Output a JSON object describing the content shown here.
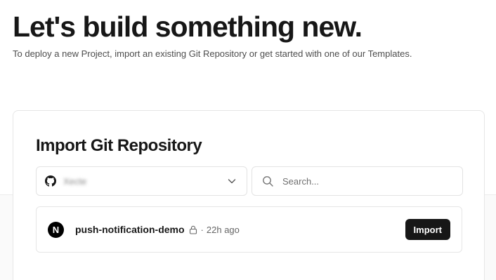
{
  "hero": {
    "title": "Let's build something new.",
    "subtitle": "To deploy a new Project, import an existing Git Repository or get started with one of our Templates."
  },
  "import_card": {
    "title": "Import Git Repository",
    "scope_selector": {
      "icon": "github-icon",
      "account_name": "Xecte"
    },
    "search": {
      "placeholder": "Search...",
      "value": ""
    },
    "repositories": [
      {
        "logo_letter": "N",
        "name": "push-notification-demo",
        "private": true,
        "separator": "·",
        "updated": "22h ago",
        "action_label": "Import"
      }
    ]
  },
  "colors": {
    "text": "#171717",
    "button_bg": "#171717",
    "button_text": "#ffffff",
    "border": "#e6e6e6",
    "muted": "#666666"
  }
}
